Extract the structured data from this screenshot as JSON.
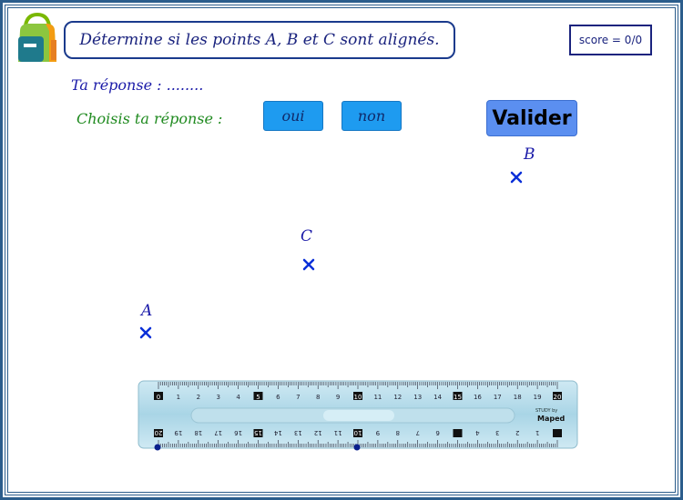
{
  "question": "Détermine si les points A,  B et C sont alignés.",
  "score": "score = 0/0",
  "answer": {
    "label": "Ta réponse :",
    "value": "........"
  },
  "choices": {
    "prompt": "Choisis ta réponse :",
    "yes": "oui",
    "no": "non"
  },
  "validate_label": "Valider",
  "points": {
    "a": "A",
    "b": "B",
    "c": "C"
  },
  "ruler": {
    "brand": "Maped",
    "brand_small": "STUDY by"
  },
  "colors": {
    "frame": "#2b5d8c",
    "text_blue": "#1a1aa8",
    "text_green": "#1f8a1f",
    "button": "#1e9bf0",
    "validate": "#5b8ff0",
    "ruler": "#b8dcea"
  }
}
